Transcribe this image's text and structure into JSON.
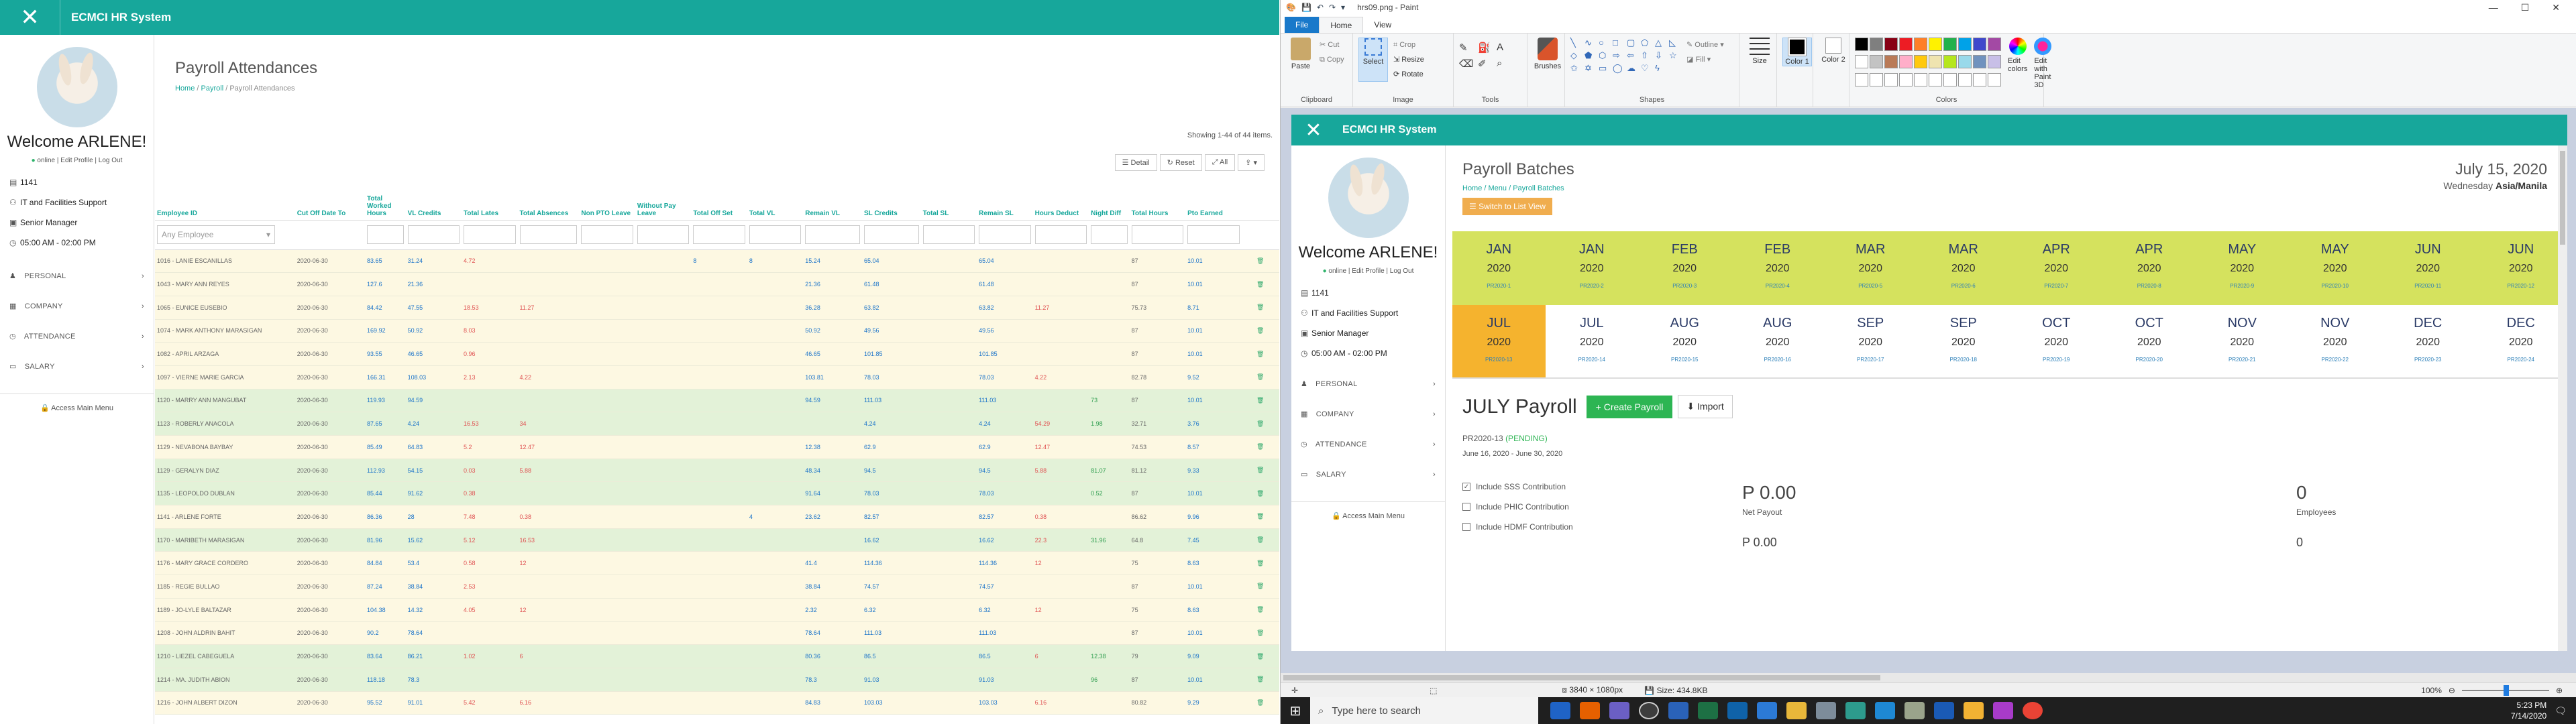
{
  "left": {
    "app_title": "ECMCI HR System",
    "user": {
      "welcome": "Welcome ARLENE!",
      "status_online": "online",
      "edit_profile": "Edit Profile",
      "logout": "Log Out",
      "id": "1141",
      "department": "IT and Facilities Support",
      "position": "Senior Manager",
      "schedule": "05:00 AM - 02:00 PM"
    },
    "nav": [
      {
        "label": "PERSONAL",
        "icon": "person-icon"
      },
      {
        "label": "COMPANY",
        "icon": "building-icon"
      },
      {
        "label": "ATTENDANCE",
        "icon": "clock-icon"
      },
      {
        "label": "SALARY",
        "icon": "money-icon"
      }
    ],
    "access_main_menu": "Access Main Menu",
    "page": {
      "title": "Payroll Attendances",
      "breadcrumb": [
        "Home",
        "Payroll",
        "Payroll Attendances"
      ],
      "showing": "Showing 1-44 of 44 items.",
      "buttons": [
        "Detail",
        "Reset",
        "All",
        ""
      ]
    },
    "table": {
      "columns": [
        "Employee ID",
        "Cut Off Date To",
        "Total Worked Hours",
        "VL Credits",
        "Total Lates",
        "Total Absences",
        "Non PTO Leave",
        "Without Pay Leave",
        "Total Off Set",
        "Total VL",
        "Remain VL",
        "SL Credits",
        "Total SL",
        "Remain SL",
        "Hours Deduct",
        "Night Diff",
        "Total Hours",
        "Pto Earned"
      ],
      "filter_placeholder": "Any Employee",
      "rows": [
        {
          "c": "y",
          "v": [
            "1016 - LANIE ESCANILLAS",
            "2020-06-30",
            "83.65",
            "31.24",
            "4.72",
            "",
            "",
            "",
            "8",
            "8",
            "15.24",
            "65.04",
            "",
            "65.04",
            "",
            "",
            "87",
            "10.01"
          ]
        },
        {
          "c": "y",
          "v": [
            "1043 - MARY ANN REYES",
            "2020-06-30",
            "127.6",
            "21.36",
            "",
            "",
            "",
            "",
            "",
            "",
            "21.36",
            "61.48",
            "",
            "61.48",
            "",
            "",
            "87",
            "10.01"
          ]
        },
        {
          "c": "y",
          "v": [
            "1065 - EUNICE EUSEBIO",
            "2020-06-30",
            "84.42",
            "47.55",
            "18.53",
            "11.27",
            "",
            "",
            "",
            "",
            "36.28",
            "63.82",
            "",
            "63.82",
            "11.27",
            "",
            "75.73",
            "8.71"
          ]
        },
        {
          "c": "y",
          "v": [
            "1074 - MARK ANTHONY MARASIGAN",
            "2020-06-30",
            "169.92",
            "50.92",
            "8.03",
            "",
            "",
            "",
            "",
            "",
            "50.92",
            "49.56",
            "",
            "49.56",
            "",
            "",
            "87",
            "10.01"
          ]
        },
        {
          "c": "y",
          "v": [
            "1082 - APRIL ARZAGA",
            "2020-06-30",
            "93.55",
            "46.65",
            "0.96",
            "",
            "",
            "",
            "",
            "",
            "46.65",
            "101.85",
            "",
            "101.85",
            "",
            "",
            "87",
            "10.01"
          ]
        },
        {
          "c": "y",
          "v": [
            "1097 - VIERNE MARIE GARCIA",
            "2020-06-30",
            "166.31",
            "108.03",
            "2.13",
            "4.22",
            "",
            "",
            "",
            "",
            "103.81",
            "78.03",
            "",
            "78.03",
            "4.22",
            "",
            "82.78",
            "9.52"
          ]
        },
        {
          "c": "g",
          "v": [
            "1120 - MARRY ANN MANGUBAT",
            "2020-06-30",
            "119.93",
            "94.59",
            "",
            "",
            "",
            "",
            "",
            "",
            "94.59",
            "111.03",
            "",
            "111.03",
            "",
            "73",
            "87",
            "10.01"
          ]
        },
        {
          "c": "g",
          "v": [
            "1123 - ROBERLY ANACOLA",
            "2020-06-30",
            "87.65",
            "4.24",
            "16.53",
            "34",
            "",
            "",
            "",
            "",
            "",
            "4.24",
            "",
            "4.24",
            "54.29",
            "1.98",
            "32.71",
            "3.76"
          ]
        },
        {
          "c": "y",
          "v": [
            "1129 - NEVABONA BAYBAY",
            "2020-06-30",
            "85.49",
            "64.83",
            "5.2",
            "12.47",
            "",
            "",
            "",
            "",
            "12.38",
            "62.9",
            "",
            "62.9",
            "12.47",
            "",
            "74.53",
            "8.57"
          ]
        },
        {
          "c": "g",
          "v": [
            "1129 - GERALYN DIAZ",
            "2020-06-30",
            "112.93",
            "54.15",
            "0.03",
            "5.88",
            "",
            "",
            "",
            "",
            "48.34",
            "94.5",
            "",
            "94.5",
            "5.88",
            "81.07",
            "81.12",
            "9.33"
          ]
        },
        {
          "c": "g",
          "v": [
            "1135 - LEOPOLDO DUBLAN",
            "2020-06-30",
            "85.44",
            "91.62",
            "0.38",
            "",
            "",
            "",
            "",
            "",
            "91.64",
            "78.03",
            "",
            "78.03",
            "",
            "0.52",
            "87",
            "10.01"
          ]
        },
        {
          "c": "y",
          "v": [
            "1141 - ARLENE FORTE",
            "2020-06-30",
            "86.36",
            "28",
            "7.48",
            "0.38",
            "",
            "",
            "",
            "4",
            "23.62",
            "82.57",
            "",
            "82.57",
            "0.38",
            "",
            "86.62",
            "9.96"
          ]
        },
        {
          "c": "g",
          "v": [
            "1170 - MARIBETH MARASIGAN",
            "2020-06-30",
            "81.96",
            "15.62",
            "5.12",
            "16.53",
            "",
            "",
            "",
            "",
            "",
            "16.62",
            "",
            "16.62",
            "22.3",
            "31.96",
            "64.8",
            "7.45"
          ]
        },
        {
          "c": "y",
          "v": [
            "1176 - MARY GRACE CORDERO",
            "2020-06-30",
            "84.84",
            "53.4",
            "0.58",
            "12",
            "",
            "",
            "",
            "",
            "41.4",
            "114.36",
            "",
            "114.36",
            "12",
            "",
            "75",
            "8.63"
          ]
        },
        {
          "c": "y",
          "v": [
            "1185 - REGIE BULLAO",
            "2020-06-30",
            "87.24",
            "38.84",
            "2.53",
            "",
            "",
            "",
            "",
            "",
            "38.84",
            "74.57",
            "",
            "74.57",
            "",
            "",
            "87",
            "10.01"
          ]
        },
        {
          "c": "y",
          "v": [
            "1189 - JO-LYLE BALTAZAR",
            "2020-06-30",
            "104.38",
            "14.32",
            "4.05",
            "12",
            "",
            "",
            "",
            "",
            "2.32",
            "6.32",
            "",
            "6.32",
            "12",
            "",
            "75",
            "8.63"
          ]
        },
        {
          "c": "y",
          "v": [
            "1208 - JOHN ALDRIN BAHIT",
            "2020-06-30",
            "90.2",
            "78.64",
            "",
            "",
            "",
            "",
            "",
            "",
            "78.64",
            "111.03",
            "",
            "111.03",
            "",
            "",
            "87",
            "10.01"
          ]
        },
        {
          "c": "g",
          "v": [
            "1210 - LIEZEL CABEGUELA",
            "2020-06-30",
            "83.64",
            "86.21",
            "1.02",
            "6",
            "",
            "",
            "",
            "",
            "80.36",
            "86.5",
            "",
            "86.5",
            "6",
            "12.38",
            "79",
            "9.09"
          ]
        },
        {
          "c": "g",
          "v": [
            "1214 - MA. JUDITH ABION",
            "2020-06-30",
            "118.18",
            "78.3",
            "",
            "",
            "",
            "",
            "",
            "",
            "78.3",
            "91.03",
            "",
            "91.03",
            "",
            "96",
            "87",
            "10.01"
          ]
        },
        {
          "c": "y",
          "v": [
            "1216 - JOHN ALBERT DIZON",
            "2020-06-30",
            "95.52",
            "91.01",
            "5.42",
            "6.16",
            "",
            "",
            "",
            "",
            "84.83",
            "103.03",
            "",
            "103.03",
            "6.16",
            "",
            "80.82",
            "9.29"
          ]
        }
      ]
    }
  },
  "paint": {
    "title": "hrs09.png - Paint",
    "tabs": [
      "File",
      "Home",
      "View"
    ],
    "groups": {
      "clipboard": {
        "label": "Clipboard",
        "paste": "Paste",
        "cut": "Cut",
        "copy": "Copy"
      },
      "image": {
        "label": "Image",
        "select": "Select",
        "crop": "Crop",
        "resize": "Resize",
        "rotate": "Rotate"
      },
      "tools": {
        "label": "Tools"
      },
      "brushes": "Brushes",
      "shapes": {
        "label": "Shapes",
        "outline": "Outline",
        "fill": "Fill"
      },
      "size": "Size",
      "color1": "Color 1",
      "color2": "Color 2",
      "colors": {
        "label": "Colors",
        "edit": "Edit colors",
        "paint3d": "Edit with Paint 3D"
      }
    },
    "palette": [
      "#000000",
      "#7f7f7f",
      "#880015",
      "#ed1c24",
      "#ff7f27",
      "#fff200",
      "#22b14c",
      "#00a2e8",
      "#3f48cc",
      "#a349a4",
      "#ffffff",
      "#c3c3c3",
      "#b97a57",
      "#ffaec9",
      "#ffc90e",
      "#efe4b0",
      "#b5e61d",
      "#99d9ea",
      "#7092be",
      "#c8bfe7"
    ],
    "status": {
      "dimensions": "3840 × 1080px",
      "size": "Size: 434.8KB",
      "zoom": "100%"
    },
    "inner": {
      "app_title": "ECMCI HR System",
      "welcome": "Welcome ARLENE!",
      "page_title": "Payroll Batches",
      "breadcrumb": "Home / Menu / Payroll Batches",
      "switch_btn": "Switch to List View",
      "date": "July 15, 2020",
      "day": "Wednesday",
      "tz": "Asia/Manila",
      "months_row1": [
        {
          "m": "JAN",
          "y": "2020",
          "c": "PR2020-1"
        },
        {
          "m": "JAN",
          "y": "2020",
          "c": "PR2020-2"
        },
        {
          "m": "FEB",
          "y": "2020",
          "c": "PR2020-3"
        },
        {
          "m": "FEB",
          "y": "2020",
          "c": "PR2020-4"
        },
        {
          "m": "MAR",
          "y": "2020",
          "c": "PR2020-5"
        },
        {
          "m": "MAR",
          "y": "2020",
          "c": "PR2020-6"
        },
        {
          "m": "APR",
          "y": "2020",
          "c": "PR2020-7"
        },
        {
          "m": "APR",
          "y": "2020",
          "c": "PR2020-8"
        },
        {
          "m": "MAY",
          "y": "2020",
          "c": "PR2020-9"
        },
        {
          "m": "MAY",
          "y": "2020",
          "c": "PR2020-10"
        },
        {
          "m": "JUN",
          "y": "2020",
          "c": "PR2020-11"
        },
        {
          "m": "JUN",
          "y": "2020",
          "c": "PR2020-12"
        }
      ],
      "months_row2": [
        {
          "m": "JUL",
          "y": "2020",
          "c": "PR2020-13"
        },
        {
          "m": "JUL",
          "y": "2020",
          "c": "PR2020-14"
        },
        {
          "m": "AUG",
          "y": "2020",
          "c": "PR2020-15"
        },
        {
          "m": "AUG",
          "y": "2020",
          "c": "PR2020-16"
        },
        {
          "m": "SEP",
          "y": "2020",
          "c": "PR2020-17"
        },
        {
          "m": "SEP",
          "y": "2020",
          "c": "PR2020-18"
        },
        {
          "m": "OCT",
          "y": "2020",
          "c": "PR2020-19"
        },
        {
          "m": "OCT",
          "y": "2020",
          "c": "PR2020-20"
        },
        {
          "m": "NOV",
          "y": "2020",
          "c": "PR2020-21"
        },
        {
          "m": "NOV",
          "y": "2020",
          "c": "PR2020-22"
        },
        {
          "m": "DEC",
          "y": "2020",
          "c": "PR2020-23"
        },
        {
          "m": "DEC",
          "y": "2020",
          "c": "PR2020-24"
        }
      ],
      "payroll_heading": "JULY Payroll",
      "create_payroll": "Create Payroll",
      "import": "Import",
      "batch_code": "PR2020-13",
      "batch_status": "(PENDING)",
      "period": "June 16, 2020 - June 30, 2020",
      "checks": [
        "Include SSS Contribution",
        "Include PHIC Contribution",
        "Include HDMF Contribution"
      ],
      "net_payout": "P 0.00",
      "net_payout_label": "Net Payout",
      "net_payout_2": "P 0.00",
      "employees": "0",
      "employees_label": "Employees",
      "employees_2": "0"
    }
  },
  "taskbar": {
    "search_placeholder": "Type here to search",
    "time": "5:23 PM",
    "date": "7/14/2020"
  }
}
